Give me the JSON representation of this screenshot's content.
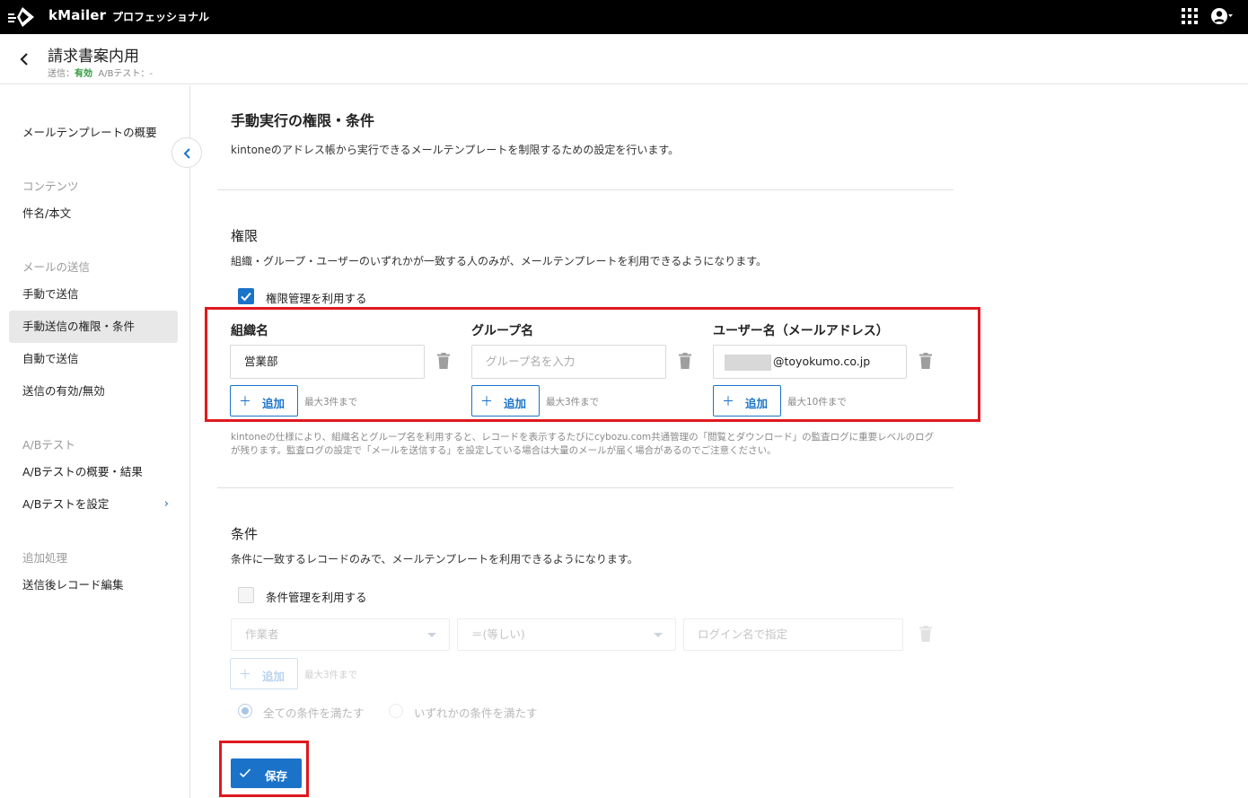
{
  "topbar": {
    "brand": "kMailer",
    "edition": "プロフェッショナル"
  },
  "header": {
    "title": "請求書案内用",
    "status_label": "送信：",
    "status_value": "有効",
    "ab_label": "A/Bテスト：-"
  },
  "sidebar": {
    "overview": "メールテンプレートの概要",
    "group_contents": "コンテンツ",
    "subject_body": "件名/本文",
    "group_send": "メールの送信",
    "manual_send": "手動で送信",
    "manual_permissions": "手動送信の権限・条件",
    "auto_send": "自動で送信",
    "send_toggle": "送信の有効/無効",
    "group_ab": "A/Bテスト",
    "ab_overview": "A/Bテストの概要・結果",
    "ab_settings": "A/Bテストを設定",
    "group_post": "追加処理",
    "post_edit": "送信後レコード編集"
  },
  "main": {
    "title": "手動実行の権限・条件",
    "description": "kintoneのアドレス帳から実行できるメールテンプレートを制限するための設定を行います。",
    "permissions": {
      "heading": "権限",
      "description": "組織・グループ・ユーザーのいずれかが一致する人のみが、メールテンプレートを利用できるようになります。",
      "checkbox_label": "権限管理を利用する",
      "checked": true,
      "org": {
        "header": "組織名",
        "value": "営業部",
        "add_label": "追加",
        "max_note": "最大3件まで"
      },
      "group": {
        "header": "グループ名",
        "placeholder": "グループ名を入力",
        "add_label": "追加",
        "max_note": "最大3件まで"
      },
      "user": {
        "header": "ユーザー名（メールアドレス）",
        "value": "@toyokumo.co.jp",
        "add_label": "追加",
        "max_note": "最大10件まで"
      },
      "note": "kintoneの仕様により、組織名とグループ名を利用すると、レコードを表示するたびにcybozu.com共通管理の「閲覧とダウンロード」の監査ログに重要レベルのログが残ります。監査ログの設定で「メールを送信する」を設定している場合は大量のメールが届く場合があるのでご注意ください。"
    },
    "conditions": {
      "heading": "条件",
      "description": "条件に一致するレコードのみで、メールテンプレートを利用できるようになります。",
      "checkbox_label": "条件管理を利用する",
      "checked": false,
      "field_select": "作業者",
      "operator_select": "＝(等しい)",
      "value_placeholder": "ログイン名で指定",
      "add_label": "追加",
      "max_note": "最大3件まで",
      "radio_all": "全ての条件を満たす",
      "radio_any": "いずれかの条件を満たす"
    },
    "save_label": "保存"
  },
  "colors": {
    "accent": "#1a73c9",
    "status_ok": "#2e9b3d",
    "highlight": "#e0181f"
  }
}
